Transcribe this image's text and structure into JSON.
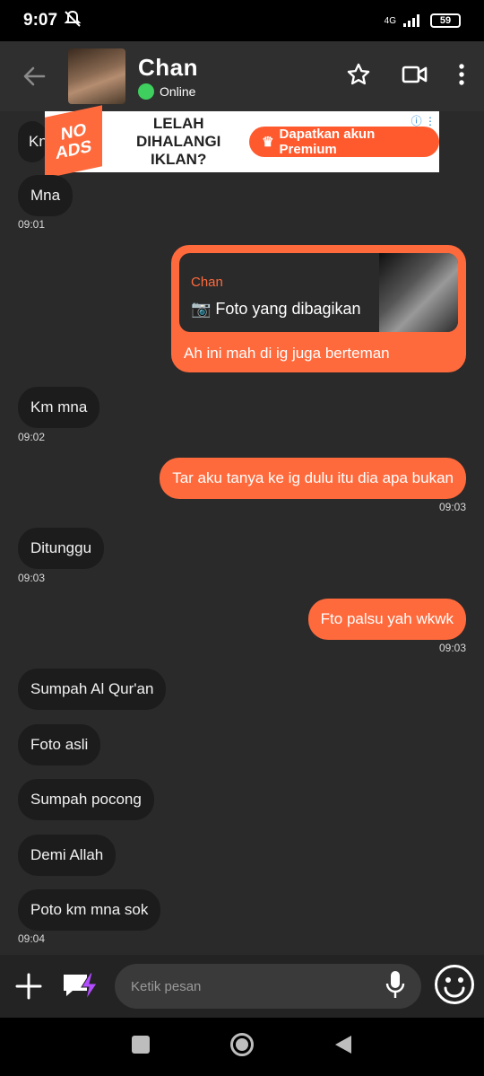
{
  "status": {
    "time": "9:07",
    "network": "4G",
    "battery": "59"
  },
  "header": {
    "name": "Chan",
    "status": "Online"
  },
  "ad": {
    "badge_line1": "NO",
    "badge_line2": "ADS",
    "text_line1": "LELAH",
    "text_line2": "DIHALANGI",
    "text_line3": "IKLAN?",
    "cta": "Dapatkan akun Premium"
  },
  "messages": {
    "m0": "Kn",
    "m1": "Mna",
    "t1": "09:01",
    "reply_name": "Chan",
    "reply_quote": "📷 Foto yang dibagikan",
    "reply_text": "Ah ini mah di ig juga berteman",
    "m3": "Km mna",
    "t3": "09:02",
    "m4": "Tar aku tanya ke ig dulu itu dia apa bukan",
    "t4": "09:03",
    "m5": "Ditunggu",
    "t5": "09:03",
    "m6": "Fto palsu yah wkwk",
    "t6": "09:03",
    "m7": "Sumpah Al Qur'an",
    "m8": "Foto asli",
    "m9": "Sumpah pocong",
    "m10": "Demi Allah",
    "m11": "Poto km mna sok",
    "t11": "09:04"
  },
  "composer": {
    "placeholder": "Ketik pesan"
  },
  "colors": {
    "accent": "#ff6a3d",
    "online": "#3ecf5e",
    "incoming": "#1c1c1c",
    "background": "#2a2a2a"
  }
}
